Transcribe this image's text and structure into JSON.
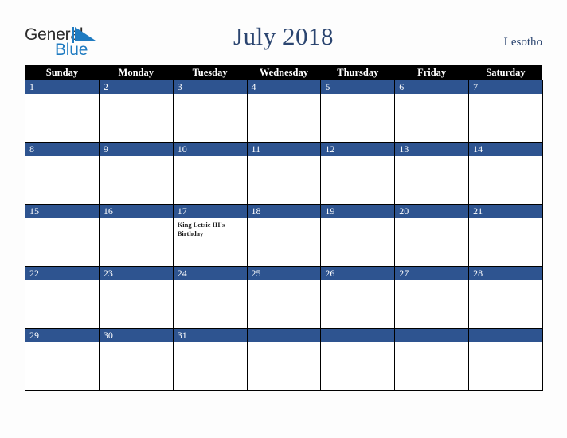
{
  "header": {
    "logo": {
      "name": "General Blue",
      "word_one": "General",
      "word_two": "Blue",
      "triangle_icon": "blue-triangle-icon",
      "color_dark": "#2b2b2b",
      "color_blue": "#1f7bc1"
    },
    "month_title": "July 2018",
    "country": "Lesotho"
  },
  "calendar": {
    "month": "July",
    "year": "2018",
    "accent_color": "#2e5490",
    "header_bg": "#000000",
    "weekdays": [
      "Sunday",
      "Monday",
      "Tuesday",
      "Wednesday",
      "Thursday",
      "Friday",
      "Saturday"
    ],
    "weeks": [
      [
        {
          "day": "1",
          "event": ""
        },
        {
          "day": "2",
          "event": ""
        },
        {
          "day": "3",
          "event": ""
        },
        {
          "day": "4",
          "event": ""
        },
        {
          "day": "5",
          "event": ""
        },
        {
          "day": "6",
          "event": ""
        },
        {
          "day": "7",
          "event": ""
        }
      ],
      [
        {
          "day": "8",
          "event": ""
        },
        {
          "day": "9",
          "event": ""
        },
        {
          "day": "10",
          "event": ""
        },
        {
          "day": "11",
          "event": ""
        },
        {
          "day": "12",
          "event": ""
        },
        {
          "day": "13",
          "event": ""
        },
        {
          "day": "14",
          "event": ""
        }
      ],
      [
        {
          "day": "15",
          "event": ""
        },
        {
          "day": "16",
          "event": ""
        },
        {
          "day": "17",
          "event": "King Letsie III's Birthday"
        },
        {
          "day": "18",
          "event": ""
        },
        {
          "day": "19",
          "event": ""
        },
        {
          "day": "20",
          "event": ""
        },
        {
          "day": "21",
          "event": ""
        }
      ],
      [
        {
          "day": "22",
          "event": ""
        },
        {
          "day": "23",
          "event": ""
        },
        {
          "day": "24",
          "event": ""
        },
        {
          "day": "25",
          "event": ""
        },
        {
          "day": "26",
          "event": ""
        },
        {
          "day": "27",
          "event": ""
        },
        {
          "day": "28",
          "event": ""
        }
      ],
      [
        {
          "day": "29",
          "event": ""
        },
        {
          "day": "30",
          "event": ""
        },
        {
          "day": "31",
          "event": ""
        },
        {
          "day": "",
          "event": ""
        },
        {
          "day": "",
          "event": ""
        },
        {
          "day": "",
          "event": ""
        },
        {
          "day": "",
          "event": ""
        }
      ]
    ]
  }
}
